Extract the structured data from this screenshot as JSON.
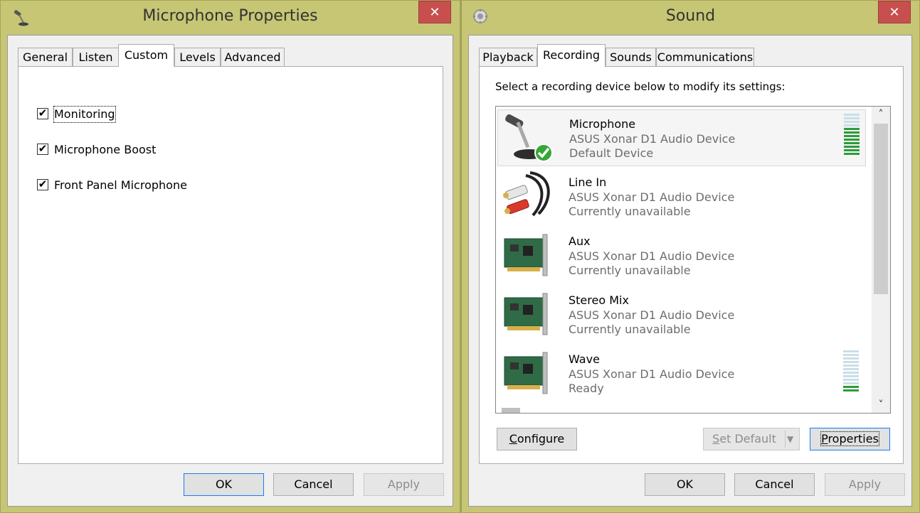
{
  "mic_window": {
    "title": "Microphone Properties",
    "close": "✕",
    "tabs": [
      "General",
      "Listen",
      "Custom",
      "Levels",
      "Advanced"
    ],
    "active_tab": "Custom",
    "checkboxes": [
      {
        "label": "Monitoring",
        "checked": true
      },
      {
        "label": "Microphone Boost",
        "checked": true
      },
      {
        "label": "Front Panel Microphone",
        "checked": true
      }
    ],
    "check_glyph": "✔",
    "buttons": {
      "ok": "OK",
      "cancel": "Cancel",
      "apply": "Apply"
    }
  },
  "sound_window": {
    "title": "Sound",
    "close": "✕",
    "tabs": [
      "Playback",
      "Recording",
      "Sounds",
      "Communications"
    ],
    "active_tab": "Recording",
    "instruction": "Select a recording device below to modify its settings:",
    "devices": [
      {
        "name": "Microphone",
        "device": "ASUS Xonar D1 Audio Device",
        "status": "Default Device",
        "icon": "microphone-icon",
        "selected": true,
        "level": 0.67
      },
      {
        "name": "Line In",
        "device": "ASUS Xonar D1 Audio Device",
        "status": "Currently unavailable",
        "icon": "rca-cable-icon"
      },
      {
        "name": "Aux",
        "device": "ASUS Xonar D1 Audio Device",
        "status": "Currently unavailable",
        "icon": "sound-card-icon"
      },
      {
        "name": "Stereo Mix",
        "device": "ASUS Xonar D1 Audio Device",
        "status": "Currently unavailable",
        "icon": "sound-card-icon"
      },
      {
        "name": "Wave",
        "device": "ASUS Xonar D1 Audio Device",
        "status": "Ready",
        "icon": "sound-card-icon",
        "level": 0.17
      }
    ],
    "scroll_up": "˄",
    "scroll_down": "˅",
    "buttons": {
      "configure_c": "C",
      "configure_rest": "onfigure",
      "set_default_s": "S",
      "set_default_rest": "et Default",
      "set_default_arrow": "▼",
      "properties_p": "P",
      "properties_rest": "roperties",
      "ok": "OK",
      "cancel": "Cancel",
      "apply": "Apply"
    }
  },
  "colors": {
    "accent": "#2c7bd6",
    "close": "#c7504f",
    "frame": "#c6c675",
    "meter_on": "#2c9c3a",
    "meter_off": "#c9dfe7"
  }
}
